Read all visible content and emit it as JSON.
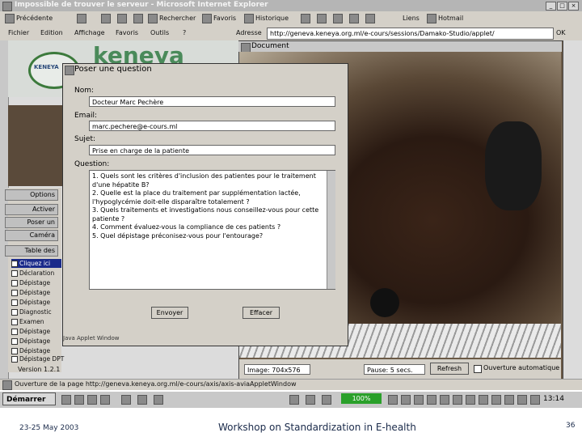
{
  "browser": {
    "title": "Impossible de trouver le serveur - Microsoft Internet Explorer",
    "toolbar": {
      "back": "Précédente",
      "search": "Rechercher",
      "favorites": "Favoris",
      "history": "Historique",
      "links": "Liens",
      "hotmail": "Hotmail"
    },
    "menu": [
      "Fichier",
      "Edition",
      "Affichage",
      "Favoris",
      "Outils",
      "?"
    ],
    "address_label": "Adresse",
    "address": "http://geneva.keneya.org.ml/e-cours/sessions/Damako-Studio/applet/",
    "go": "OK",
    "status": "Ouverture de la page http://geneva.keneya.org.ml/e-cours/axis/axis-aviaAppletWindow"
  },
  "left_panel": {
    "logo_text": "KENEYA",
    "logo_word": "keneya",
    "buttons": [
      "Options",
      "Activer",
      "Poser un",
      "Caméra",
      "Table des"
    ],
    "tree": [
      "Cliquez ici",
      "Déclaration",
      "Dépistage",
      "Dépistage",
      "Dépistage",
      "Diagnostic",
      "Examen",
      "Dépistage",
      "Dépistage",
      "Dépistage",
      "Dépistage DPT",
      "Dépistage DPT"
    ],
    "version": "Version 1.2.1"
  },
  "document_window": {
    "title": "Document",
    "image_label": "Image: 704x576",
    "pause_label": "Pause: 5 secs.",
    "refresh": "Refresh",
    "auto_open": "Ouverture automatique"
  },
  "dialog": {
    "title": "Poser une question",
    "name_label": "Nom:",
    "name_value": "Docteur Marc Pechère",
    "email_label": "Email:",
    "email_value": "marc.pechere@e-cours.ml",
    "subject_label": "Sujet:",
    "subject_value": "Prise en charge de la patiente",
    "question_label": "Question:",
    "question_text": "1. Quels sont les critères d'inclusion des patientes pour le traitement d'une hépatite B?\n2. Quelle est la place du traitement par supplémentation lactée, l'hypoglycémie doit-elle disparaître totalement ?\n3. Quels traitements et investigations nous conseillez-vous pour cette patiente ?\n4. Comment évaluez-vous la compliance de ces patients ?\n5. Quel dépistage préconisez-vous pour l'entourage?",
    "send": "Envoyer",
    "clear": "Effacer",
    "footer": "Java Applet Window"
  },
  "taskbar": {
    "start": "Démarrer",
    "zoom": "100%",
    "clock": "13:14"
  },
  "slide": {
    "date": "23-25 May 2003",
    "title": "Workshop on Standardization in E-health",
    "page": "36"
  }
}
